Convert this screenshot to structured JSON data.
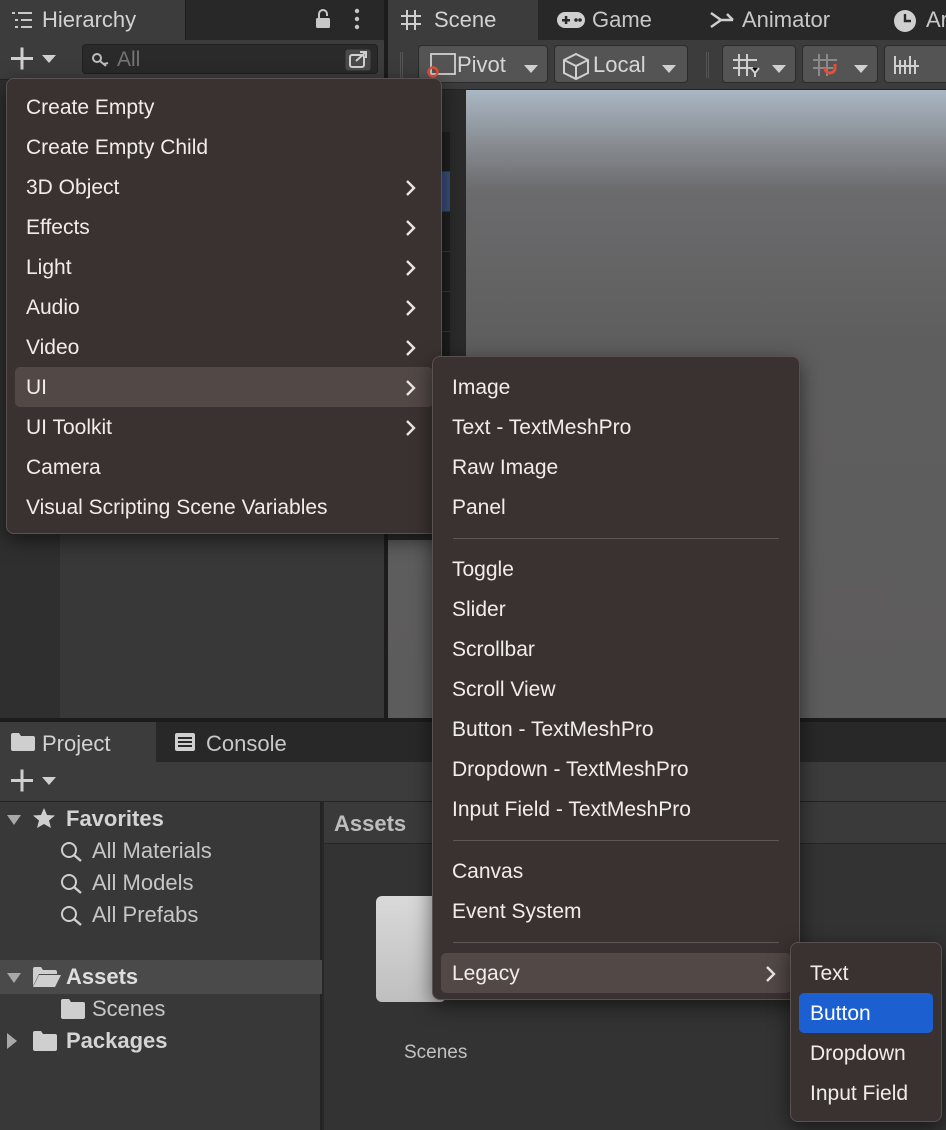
{
  "hierarchy": {
    "tab_label": "Hierarchy",
    "search_placeholder": "All"
  },
  "scene": {
    "tabs": [
      {
        "label": "Scene"
      },
      {
        "label": "Game"
      },
      {
        "label": "Animator"
      },
      {
        "label": "Ar"
      }
    ],
    "toolbar": {
      "pivot_label": "Pivot",
      "local_label": "Local"
    }
  },
  "bottom": {
    "tabs": [
      {
        "label": "Project"
      },
      {
        "label": "Console"
      }
    ],
    "tree": {
      "favorites_label": "Favorites",
      "favorites_items": [
        "All Materials",
        "All Models",
        "All Prefabs"
      ],
      "assets_label": "Assets",
      "assets_children": [
        "Scenes"
      ],
      "packages_label": "Packages"
    },
    "assets_header": "Assets",
    "assets_grid": [
      {
        "label": "Scenes"
      }
    ]
  },
  "menus": {
    "main": [
      {
        "label": "Create Empty",
        "submenu": false
      },
      {
        "label": "Create Empty Child",
        "submenu": false
      },
      {
        "label": "3D Object",
        "submenu": true
      },
      {
        "label": "Effects",
        "submenu": true
      },
      {
        "label": "Light",
        "submenu": true
      },
      {
        "label": "Audio",
        "submenu": true
      },
      {
        "label": "Video",
        "submenu": true
      },
      {
        "label": "UI",
        "submenu": true,
        "active": true
      },
      {
        "label": "UI Toolkit",
        "submenu": true
      },
      {
        "label": "Camera",
        "submenu": false
      },
      {
        "label": "Visual Scripting Scene Variables",
        "submenu": false
      }
    ],
    "ui": {
      "group1": [
        "Image",
        "Text - TextMeshPro",
        "Raw Image",
        "Panel"
      ],
      "group2": [
        "Toggle",
        "Slider",
        "Scrollbar",
        "Scroll View",
        "Button - TextMeshPro",
        "Dropdown - TextMeshPro",
        "Input Field - TextMeshPro"
      ],
      "group3": [
        "Canvas",
        "Event System"
      ],
      "group4": [
        {
          "label": "Legacy",
          "submenu": true,
          "active": true
        }
      ]
    },
    "legacy": [
      {
        "label": "Text"
      },
      {
        "label": "Button",
        "selected": true
      },
      {
        "label": "Dropdown"
      },
      {
        "label": "Input Field"
      }
    ]
  },
  "colors": {
    "selection": "#1b5fd0",
    "menu_bg": "#3a3230",
    "panel_bg": "#383838"
  }
}
